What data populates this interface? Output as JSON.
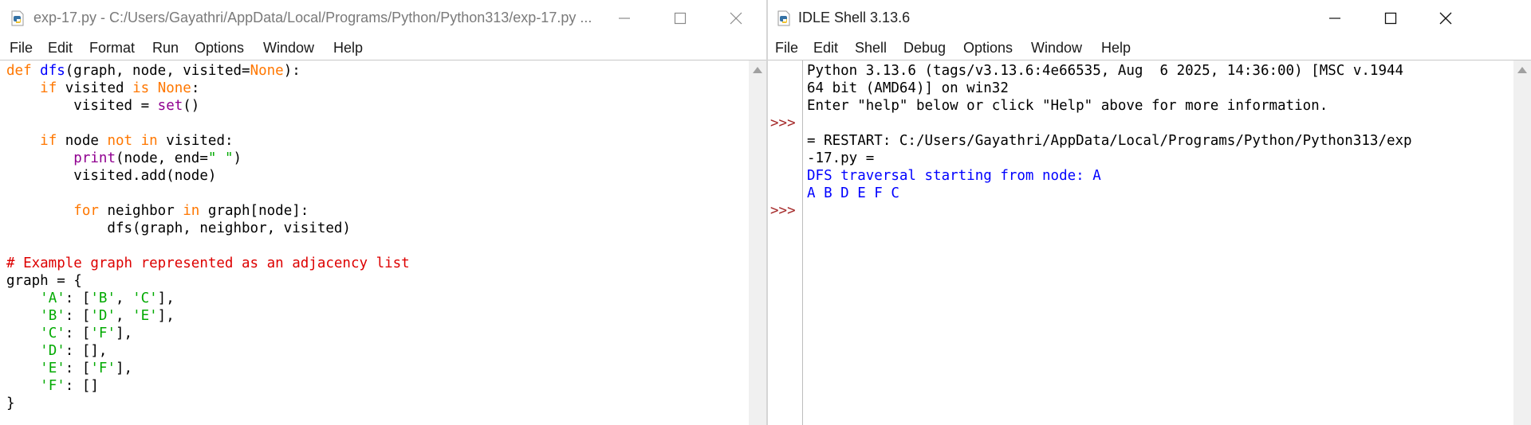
{
  "editor": {
    "title": "exp-17.py - C:/Users/Gayathri/AppData/Local/Programs/Python/Python313/exp-17.py ...",
    "menu": [
      "File",
      "Edit",
      "Format",
      "Run",
      "Options",
      "Window",
      "Help"
    ],
    "code_lines": [
      "def dfs(graph, node, visited=None):",
      "    if visited is None:",
      "        visited = set()",
      "",
      "    if node not in visited:",
      "        print(node, end=\" \")",
      "        visited.add(node)",
      "",
      "        for neighbor in graph[node]:",
      "            dfs(graph, neighbor, visited)",
      "",
      "# Example graph represented as an adjacency list",
      "graph = {",
      "    'A': ['B', 'C'],",
      "    'B': ['D', 'E'],",
      "    'C': ['F'],",
      "    'D': [],",
      "    'E': ['F'],",
      "    'F': []",
      "}"
    ]
  },
  "shell": {
    "title": "IDLE Shell 3.13.6",
    "menu": [
      "File",
      "Edit",
      "Shell",
      "Debug",
      "Options",
      "Window",
      "Help"
    ],
    "prompt": ">>>",
    "banner_lines": [
      "Python 3.13.6 (tags/v3.13.6:4e66535, Aug  6 2025, 14:36:00) [MSC v.1944",
      "64 bit (AMD64)] on win32",
      "Enter \"help\" below or click \"Help\" above for more information."
    ],
    "restart_lines": [
      "= RESTART: C:/Users/Gayathri/AppData/Local/Programs/Python/Python313/exp",
      "-17.py ="
    ],
    "output_lines": [
      "DFS traversal starting from node: A",
      "A B D E F C"
    ]
  }
}
